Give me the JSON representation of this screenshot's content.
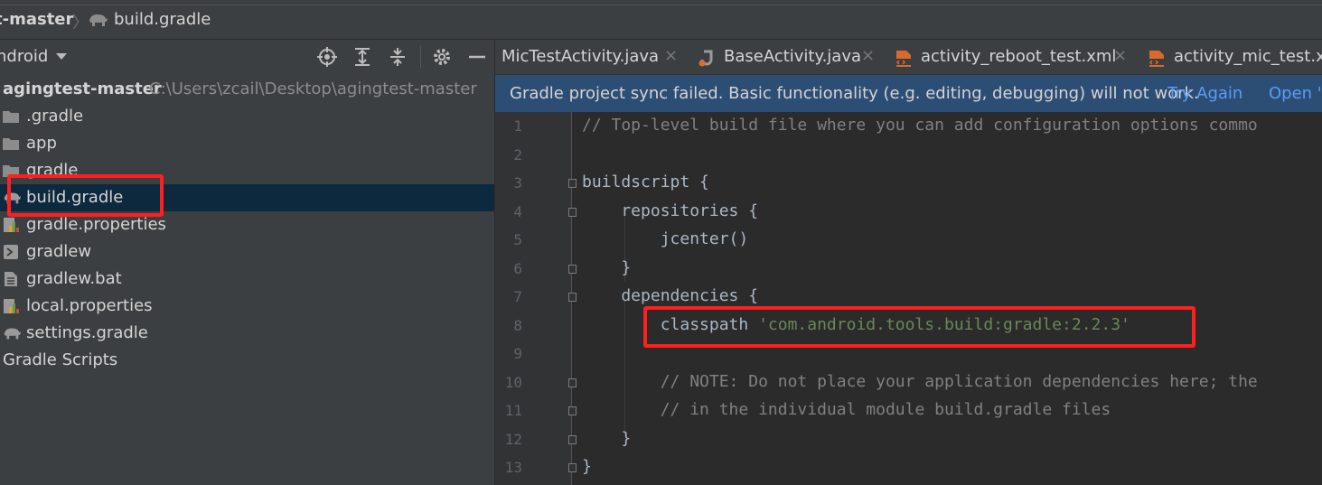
{
  "breadcrumb": {
    "project": "t-master",
    "separator": "〉",
    "file": "build.gradle"
  },
  "project_panel": {
    "view": "ndroid",
    "root": {
      "name": "agingtest-master",
      "path": "C:\\Users\\zcail\\Desktop\\agingtest-master"
    },
    "items": [
      {
        "label": ".gradle",
        "icon": "folder-icon"
      },
      {
        "label": "app",
        "icon": "folder-icon"
      },
      {
        "label": "gradle",
        "icon": "folder-icon"
      },
      {
        "label": "build.gradle",
        "icon": "gradle-elephant-icon",
        "selected": true
      },
      {
        "label": "gradle.properties",
        "icon": "properties-file-icon"
      },
      {
        "label": "gradlew",
        "icon": "script-file-icon"
      },
      {
        "label": "gradlew.bat",
        "icon": "text-file-icon"
      },
      {
        "label": "local.properties",
        "icon": "properties-file-icon"
      },
      {
        "label": "settings.gradle",
        "icon": "gradle-elephant-icon"
      }
    ],
    "scripts": "Gradle Scripts",
    "tools": [
      "locate-icon",
      "expand-all-icon",
      "collapse-all-icon",
      "gear-icon",
      "minimize-icon"
    ]
  },
  "tabs": [
    {
      "label": "MicTestActivity.java",
      "close": "×"
    },
    {
      "label": "BaseActivity.java",
      "close": "×",
      "icon": "java-file-icon"
    },
    {
      "label": "activity_reboot_test.xml",
      "close": "×",
      "icon": "xml-file-icon"
    },
    {
      "label": "activity_mic_test.xm",
      "icon": "xml-file-icon"
    }
  ],
  "banner": {
    "message": "Gradle project sync failed. Basic functionality (e.g. editing, debugging) will not work.",
    "try_again": "Try Again",
    "open": "Open '"
  },
  "code_lines": [
    {
      "n": "1",
      "text": "// Top-level build file where you can add configuration options commo"
    },
    {
      "n": "2",
      "text": ""
    },
    {
      "n": "3",
      "text": "buildscript {"
    },
    {
      "n": "4",
      "text": "    repositories {"
    },
    {
      "n": "5",
      "text": "        jcenter()"
    },
    {
      "n": "6",
      "text": "    }"
    },
    {
      "n": "7",
      "text": "    dependencies {"
    },
    {
      "n": "8",
      "text": "        classpath ",
      "string": "'com.android.tools.build:gradle:2.2.3'"
    },
    {
      "n": "9",
      "text": ""
    },
    {
      "n": "10",
      "text": "        // NOTE: Do not place your application dependencies here; the"
    },
    {
      "n": "11",
      "text": "        // in the individual module build.gradle files"
    },
    {
      "n": "12",
      "text": "    }"
    },
    {
      "n": "13",
      "text": "}"
    }
  ],
  "colors": {
    "highlight": "#ff1f1f",
    "banner": "#2d4e74",
    "link": "#589df6",
    "string": "#6a8759",
    "comment": "#808080",
    "selection": "#0d293e"
  }
}
